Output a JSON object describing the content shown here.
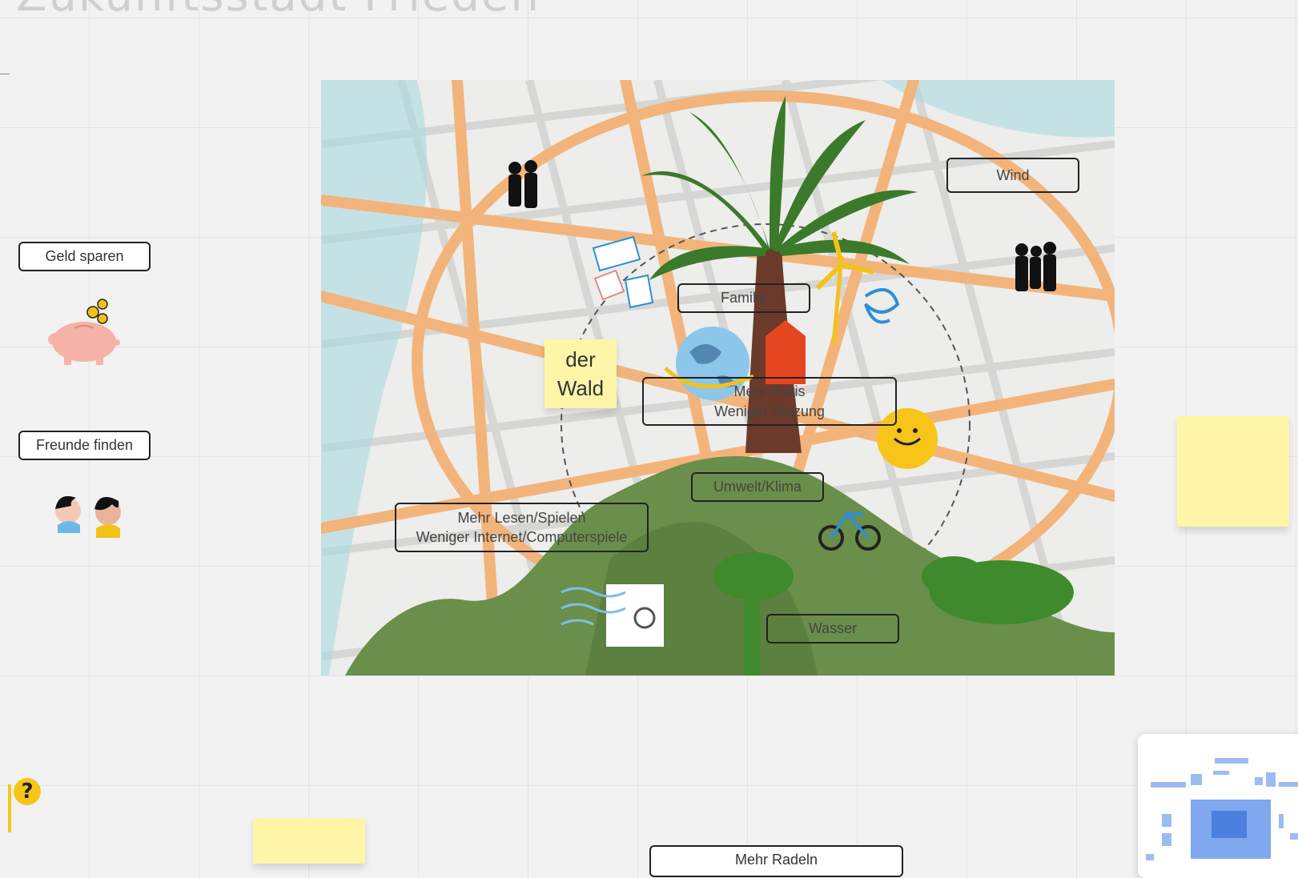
{
  "board": {
    "title": "Zukunftsstadt Frieden"
  },
  "labels": {
    "geld_sparen": "Geld sparen",
    "freunde_finden": "Freunde finden",
    "wind": "Wind",
    "familie": "Familie",
    "mehr_pulli_line1": "Mehr Pullis",
    "mehr_pulli_line2": "Weniger Heizung",
    "umwelt_klima": "Umwelt/Klima",
    "mehr_lesen_line1": "Mehr Lesen/Spielen",
    "mehr_lesen_line2": "Weniger Internet/Computerspiele",
    "wasser": "Wasser",
    "mehr_radeln": "Mehr Radeln"
  },
  "sticky_wald": {
    "line1": "der",
    "line2": "Wald"
  },
  "help": {
    "symbol": "?"
  },
  "colors": {
    "sticky": "#fff5a8",
    "map_road": "#f2b47a",
    "map_water": "#a9dbe3",
    "hill": "#6a8f4a",
    "palm": "#3b7a2a",
    "trunk": "#6b3a2a"
  }
}
